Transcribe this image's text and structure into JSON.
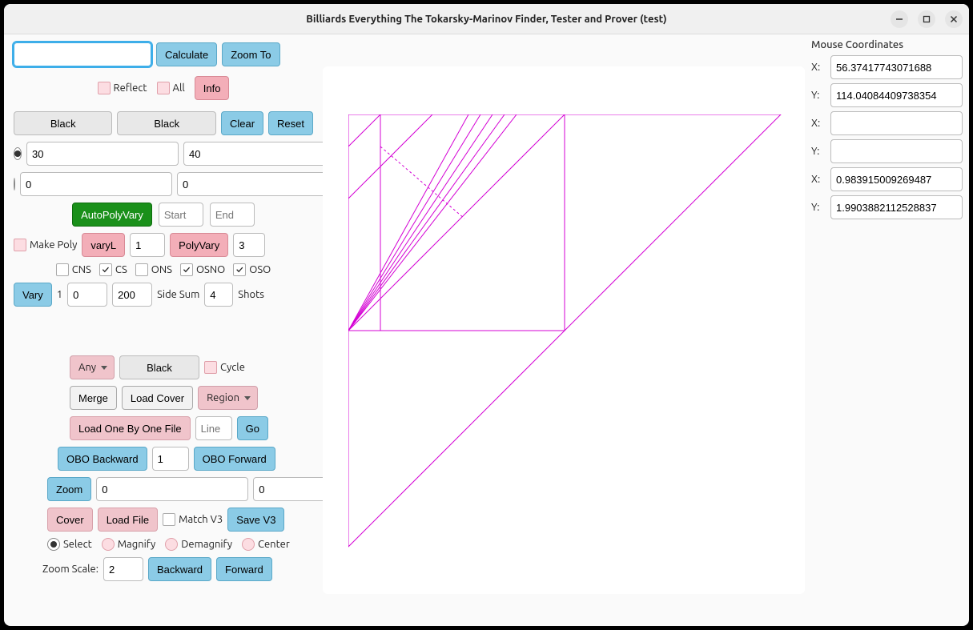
{
  "window": {
    "title": "Billiards Everything The Tokarsky-Marinov Finder, Tester and Prover (test)"
  },
  "top": {
    "main_input": "",
    "calculate": "Calculate",
    "zoom_to": "Zoom To",
    "reflect": "Reflect",
    "all": "All",
    "info": "Info"
  },
  "black_row": {
    "black1": "Black",
    "black2": "Black",
    "clear": "Clear",
    "reset": "Reset"
  },
  "coords": {
    "row1a": "30",
    "row1b": "40",
    "row2a": "0",
    "row2b": "0"
  },
  "auto": {
    "auto_poly_vary": "AutoPolyVary",
    "start_ph": "Start",
    "end_ph": "End"
  },
  "makepoly": {
    "make_poly": "Make Poly",
    "varyL": "varyL",
    "varyL_val": "1",
    "polyvary": "PolyVary",
    "polyvary_val": "3"
  },
  "checks": {
    "cns": "CNS",
    "cs": "CS",
    "ons": "ONS",
    "osno": "OSNO",
    "oso": "OSO"
  },
  "vary": {
    "vary": "Vary",
    "n1": "1",
    "n2": "0",
    "n3": "200",
    "side_sum": "Side Sum",
    "n4": "4",
    "shots": "Shots"
  },
  "mid": {
    "any": "Any",
    "black": "Black",
    "cycle": "Cycle",
    "merge": "Merge",
    "load_cover": "Load Cover",
    "region": "Region",
    "load_obo": "Load One By One File",
    "line_ph": "Line",
    "go": "Go",
    "obo_back": "OBO Backward",
    "obo_val": "1",
    "obo_fwd": "OBO Forward",
    "zoom": "Zoom",
    "zoom_a": "0",
    "zoom_b": "0",
    "cover": "Cover",
    "load_file": "Load File",
    "match_v3": "Match V3",
    "save_v3": "Save V3"
  },
  "bottom_radios": {
    "select": "Select",
    "magnify": "Magnify",
    "demagnify": "Demagnify",
    "center": "Center"
  },
  "zoom_row": {
    "zoom_scale": "Zoom Scale:",
    "zoom_scale_val": "2",
    "backward": "Backward",
    "forward": "Forward"
  },
  "right": {
    "title": "Mouse Coordinates",
    "x": "X:",
    "y": "Y:",
    "x1": "56.37417743071688",
    "y1": "114.04084409738354",
    "x2": "",
    "y2": "",
    "x3": "0.983915009269487",
    "y3": "1.9903882112528837"
  }
}
